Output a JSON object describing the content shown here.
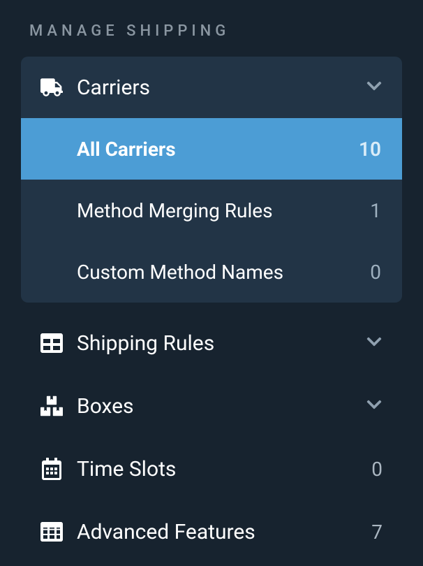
{
  "section_title": "Manage Shipping",
  "carriers": {
    "label": "Carriers",
    "items": [
      {
        "label": "All Carriers",
        "count": "10"
      },
      {
        "label": "Method Merging Rules",
        "count": "1"
      },
      {
        "label": "Custom Method Names",
        "count": "0"
      }
    ]
  },
  "menu": {
    "shipping_rules": {
      "label": "Shipping Rules"
    },
    "boxes": {
      "label": "Boxes"
    },
    "time_slots": {
      "label": "Time Slots",
      "count": "0"
    },
    "advanced_features": {
      "label": "Advanced Features",
      "count": "7"
    }
  }
}
